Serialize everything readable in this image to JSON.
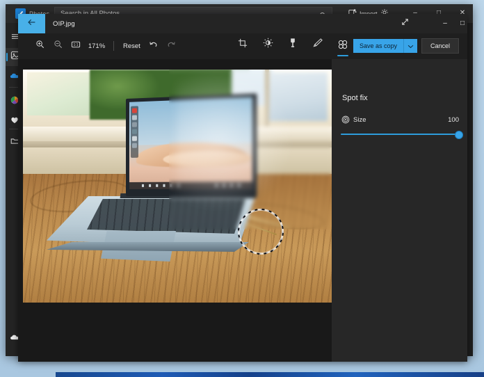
{
  "desktop": {
    "background_color": "#b9d3e8",
    "taskbar_color": "#1a4f9e"
  },
  "photos_window": {
    "app_label": "Photos",
    "logo_icon": "photos-app-icon",
    "search": {
      "placeholder": "Search in All Photos",
      "value": "Search in All Photos",
      "icon": "search-icon"
    },
    "import": {
      "label": "Import",
      "icon": "import-icon"
    },
    "settings": {
      "icon": "gear-icon"
    },
    "caption_buttons": {
      "minimize": "–",
      "maximize": "□",
      "close": "✕"
    },
    "rail": [
      {
        "name": "menu",
        "icon": "hamburger-icon",
        "selected": false
      },
      {
        "name": "collection",
        "icon": "photos-collection-icon",
        "selected": true
      },
      {
        "name": "onedrive",
        "icon": "onedrive-cloud-icon",
        "selected": false
      },
      {
        "name": "people",
        "icon": "colorful-app-icon",
        "selected": false
      },
      {
        "name": "favorites",
        "icon": "heart-icon",
        "selected": false
      },
      {
        "name": "folders",
        "icon": "folder-icon",
        "selected": false
      },
      {
        "name": "cloud-status",
        "icon": "cloud-icon",
        "selected": false
      }
    ]
  },
  "editor": {
    "back_button": {
      "icon": "back-arrow-icon"
    },
    "file_name": "OIP.jpg",
    "expand_icon": "expand-diagonal-icon",
    "caption_buttons": {
      "minimize": "–",
      "maximize": "□",
      "close": "✕"
    },
    "toolbar": {
      "zoom_in_icon": "zoom-in-icon",
      "zoom_out_icon": "zoom-out-icon",
      "fit_icon": "fit-to-window-icon",
      "zoom_level": "171%",
      "reset_label": "Reset",
      "undo_icon": "undo-icon",
      "redo_icon": "redo-icon",
      "tools": [
        {
          "name": "crop",
          "icon": "crop-icon",
          "selected": false
        },
        {
          "name": "adjustment",
          "icon": "brightness-icon",
          "selected": false
        },
        {
          "name": "filters",
          "icon": "filter-icon",
          "selected": false
        },
        {
          "name": "markup",
          "icon": "pen-markup-icon",
          "selected": false
        },
        {
          "name": "spot-fix",
          "icon": "spot-fix-icon",
          "selected": true
        }
      ],
      "save_as_copy_label": "Save as copy",
      "save_caret_icon": "chevron-down-icon",
      "cancel_label": "Cancel",
      "accent_color": "#38a4e8"
    },
    "canvas": {
      "image_alt": "Surface Laptop Go open on a wooden table in front of a bright window",
      "brush_cursor": "spot-fix-brush-cursor"
    },
    "panel": {
      "title": "Spot fix",
      "size_icon": "brush-size-icon",
      "size_label": "Size",
      "size_value": "100",
      "slider_min": "0",
      "slider_max": "100",
      "slider_color": "#2d9cdb"
    }
  }
}
